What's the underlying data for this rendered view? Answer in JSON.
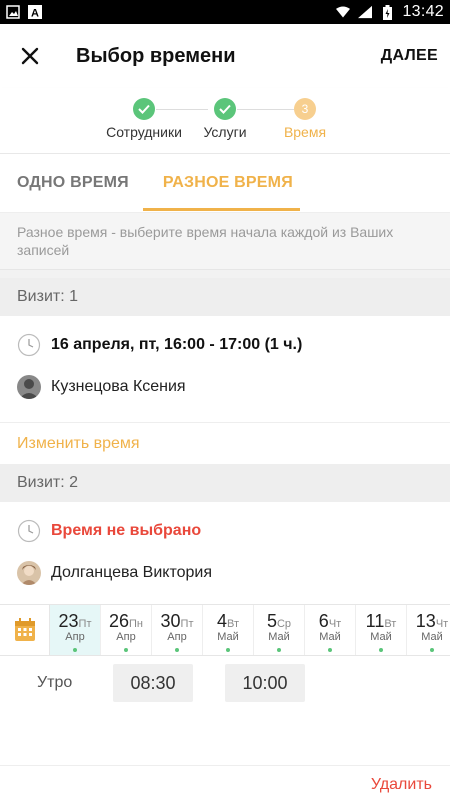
{
  "status_bar": {
    "time": "13:42",
    "left_icons": [
      "image-icon",
      "font-a-icon"
    ],
    "right_icons": [
      "wifi-icon",
      "signal-icon",
      "battery-icon"
    ]
  },
  "app_bar": {
    "title": "Выбор времени",
    "next_label": "ДАЛЕЕ"
  },
  "stepper": {
    "steps": [
      {
        "label": "Сотрудники",
        "state": "done",
        "badge": ""
      },
      {
        "label": "Услуги",
        "state": "done",
        "badge": ""
      },
      {
        "label": "Время",
        "state": "current",
        "badge": "3"
      }
    ]
  },
  "tabs": [
    {
      "label": "ОДНО ВРЕМЯ",
      "active": false
    },
    {
      "label": "РАЗНОЕ ВРЕМЯ",
      "active": true
    }
  ],
  "info_note": "Разное время - выберите время начала каждой из Ваших записей",
  "visits": [
    {
      "header": "Визит: 1",
      "time": "16 апреля, пт, 16:00 - 17:00 (1 ч.)",
      "staff": "Кузнецова Ксения",
      "change_label": "Изменить время"
    },
    {
      "header": "Визит: 2",
      "time": "Время не выбрано",
      "staff": "Долганцева Виктория"
    }
  ],
  "dates": [
    {
      "num": "23",
      "dow": "Пт",
      "mon": "Апр",
      "selected": true
    },
    {
      "num": "26",
      "dow": "Пн",
      "mon": "Апр",
      "selected": false
    },
    {
      "num": "30",
      "dow": "Пт",
      "mon": "Апр",
      "selected": false
    },
    {
      "num": "4",
      "dow": "Вт",
      "mon": "Май",
      "selected": false
    },
    {
      "num": "5",
      "dow": "Ср",
      "mon": "Май",
      "selected": false
    },
    {
      "num": "6",
      "dow": "Чт",
      "mon": "Май",
      "selected": false
    },
    {
      "num": "11",
      "dow": "Вт",
      "mon": "Май",
      "selected": false
    },
    {
      "num": "13",
      "dow": "Чт",
      "mon": "Май",
      "selected": false
    }
  ],
  "slots": {
    "label": "Утро",
    "times": [
      "08:30",
      "10:00"
    ]
  },
  "delete_label": "Удалить",
  "colors": {
    "accent": "#f0b24a",
    "done": "#5bc57a",
    "error": "#e9483b",
    "selected_date_bg": "#e6f7f7"
  }
}
